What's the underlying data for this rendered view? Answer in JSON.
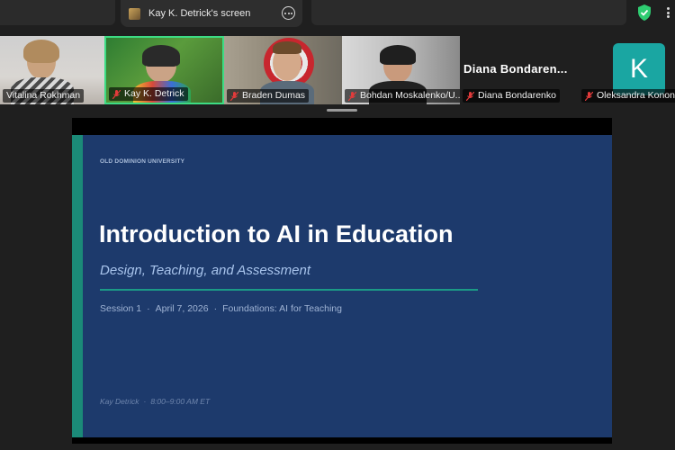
{
  "window": {
    "shared_tab_title": "Kay K. Detrick's screen"
  },
  "participants": [
    {
      "name": "Vitalina Rokhman",
      "muted": false
    },
    {
      "name": "Kay K. Detrick",
      "muted": true,
      "speaking": true
    },
    {
      "name": "Braden Dumas",
      "muted": true
    },
    {
      "name": "Bohdan Moskalenko/U...",
      "muted": true
    },
    {
      "name": "Diana Bondarenko",
      "muted": true,
      "display_name": "Diana  Bondaren..."
    },
    {
      "name": "Oleksandra Konone",
      "muted": true,
      "avatar_letter": "K"
    }
  ],
  "slide": {
    "institution": "OLD DOMINION UNIVERSITY",
    "title": "Introduction to AI in Education",
    "subtitle": "Design, Teaching, and Assessment",
    "session": "Session 1",
    "date": "April 7, 2026",
    "topic": "Foundations: AI for Teaching",
    "separator": "·",
    "presenter": "Kay Detrick",
    "time": "8:00–9:00 AM ET"
  },
  "colors": {
    "slide_bg": "#1d3a6c",
    "accent_teal": "#1b8a78",
    "speaking_border": "#3ddc84",
    "avatar_bg": "#1aa6a2",
    "shield_green": "#2ecc71"
  }
}
